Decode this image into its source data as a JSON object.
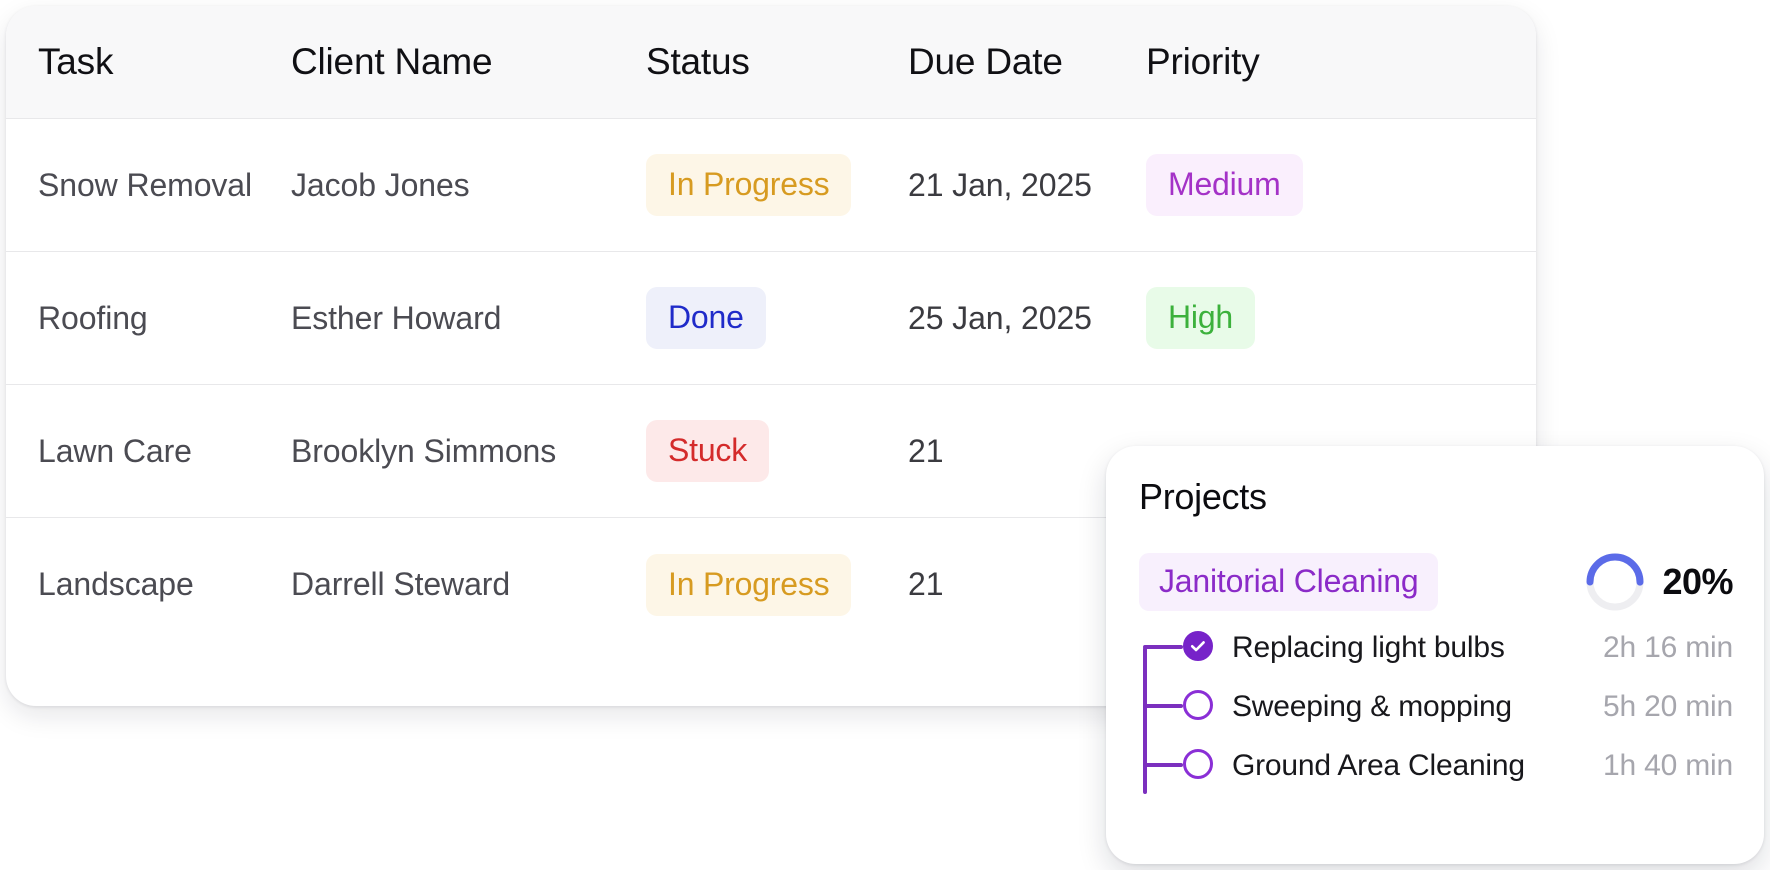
{
  "table": {
    "columns": [
      {
        "key": "task",
        "label": "Task"
      },
      {
        "key": "client",
        "label": "Client Name"
      },
      {
        "key": "status",
        "label": "Status"
      },
      {
        "key": "due",
        "label": "Due Date"
      },
      {
        "key": "priority",
        "label": "Priority"
      }
    ],
    "rows": [
      {
        "task": "Snow Removal",
        "client": "Jacob Jones",
        "status": "In Progress",
        "status_bg": "#fdf6e7",
        "status_fg": "#d79b21",
        "due": "21 Jan, 2025",
        "priority": "Medium",
        "priority_bg": "#faeffd",
        "priority_fg": "#a432c7"
      },
      {
        "task": "Roofing",
        "client": "Esther Howard",
        "status": "Done",
        "status_bg": "#eef0fa",
        "status_fg": "#1f2bc9",
        "due": "25 Jan, 2025",
        "priority": "High",
        "priority_bg": "#e8fbe8",
        "priority_fg": "#3cb13c"
      },
      {
        "task": "Lawn Care",
        "client": "Brooklyn Simmons",
        "status": "Stuck",
        "status_bg": "#fde9e9",
        "status_fg": "#d42b2b",
        "due": "21",
        "priority": "",
        "priority_bg": "transparent",
        "priority_fg": "#000000"
      },
      {
        "task": "Landscape",
        "client": "Darrell Steward",
        "status": "In Progress",
        "status_bg": "#fdf6e7",
        "status_fg": "#d79b21",
        "due": "21",
        "priority": "",
        "priority_bg": "transparent",
        "priority_fg": "#000000"
      }
    ]
  },
  "projects": {
    "title": "Projects",
    "chip_label": "Janitorial Cleaning",
    "chip_bg": "#f8f0fd",
    "chip_fg": "#8b2bc8",
    "progress_percent": 20,
    "progress_label": "20%",
    "progress_color": "#5b6be8",
    "progress_track": "#eeeef1",
    "accent_purple": "#7b2fbe",
    "tasks": [
      {
        "label": "Replacing light bulbs",
        "time": "2h 16 min",
        "done": true
      },
      {
        "label": "Sweeping & mopping",
        "time": "5h 20 min",
        "done": false
      },
      {
        "label": "Ground Area Cleaning",
        "time": "1h 40 min",
        "done": false
      }
    ]
  }
}
